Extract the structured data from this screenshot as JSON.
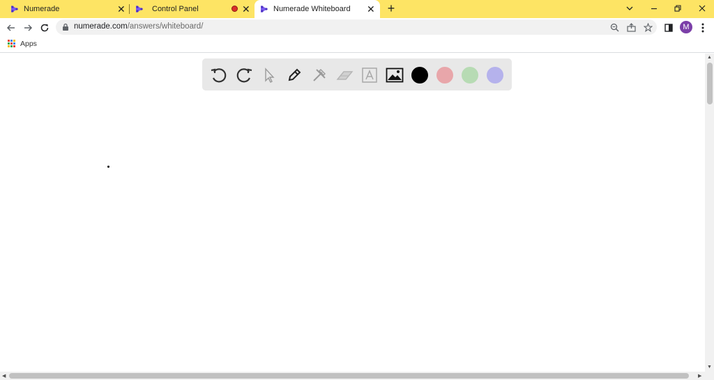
{
  "tabs": [
    {
      "title": "Numerade",
      "active": false
    },
    {
      "title": "Control Panel",
      "active": false,
      "recording": true
    },
    {
      "title": "Numerade Whiteboard",
      "active": true
    }
  ],
  "address_bar": {
    "domain": "numerade.com",
    "path": "/answers/whiteboard/"
  },
  "profile": {
    "initial": "M",
    "color": "#7b3fa8"
  },
  "bookmarks": [
    {
      "label": "Apps"
    }
  ],
  "whiteboard": {
    "tools": [
      "undo-icon",
      "redo-icon",
      "pointer-icon",
      "pen-icon",
      "tools-icon",
      "eraser-icon",
      "text-icon",
      "image-icon"
    ],
    "colors": [
      "#000000",
      "#e8a6aa",
      "#b7dbb4",
      "#b5b2ec"
    ]
  },
  "theme": {
    "tabbar_bg": "#fde464",
    "accent": "#7b5cf0"
  }
}
